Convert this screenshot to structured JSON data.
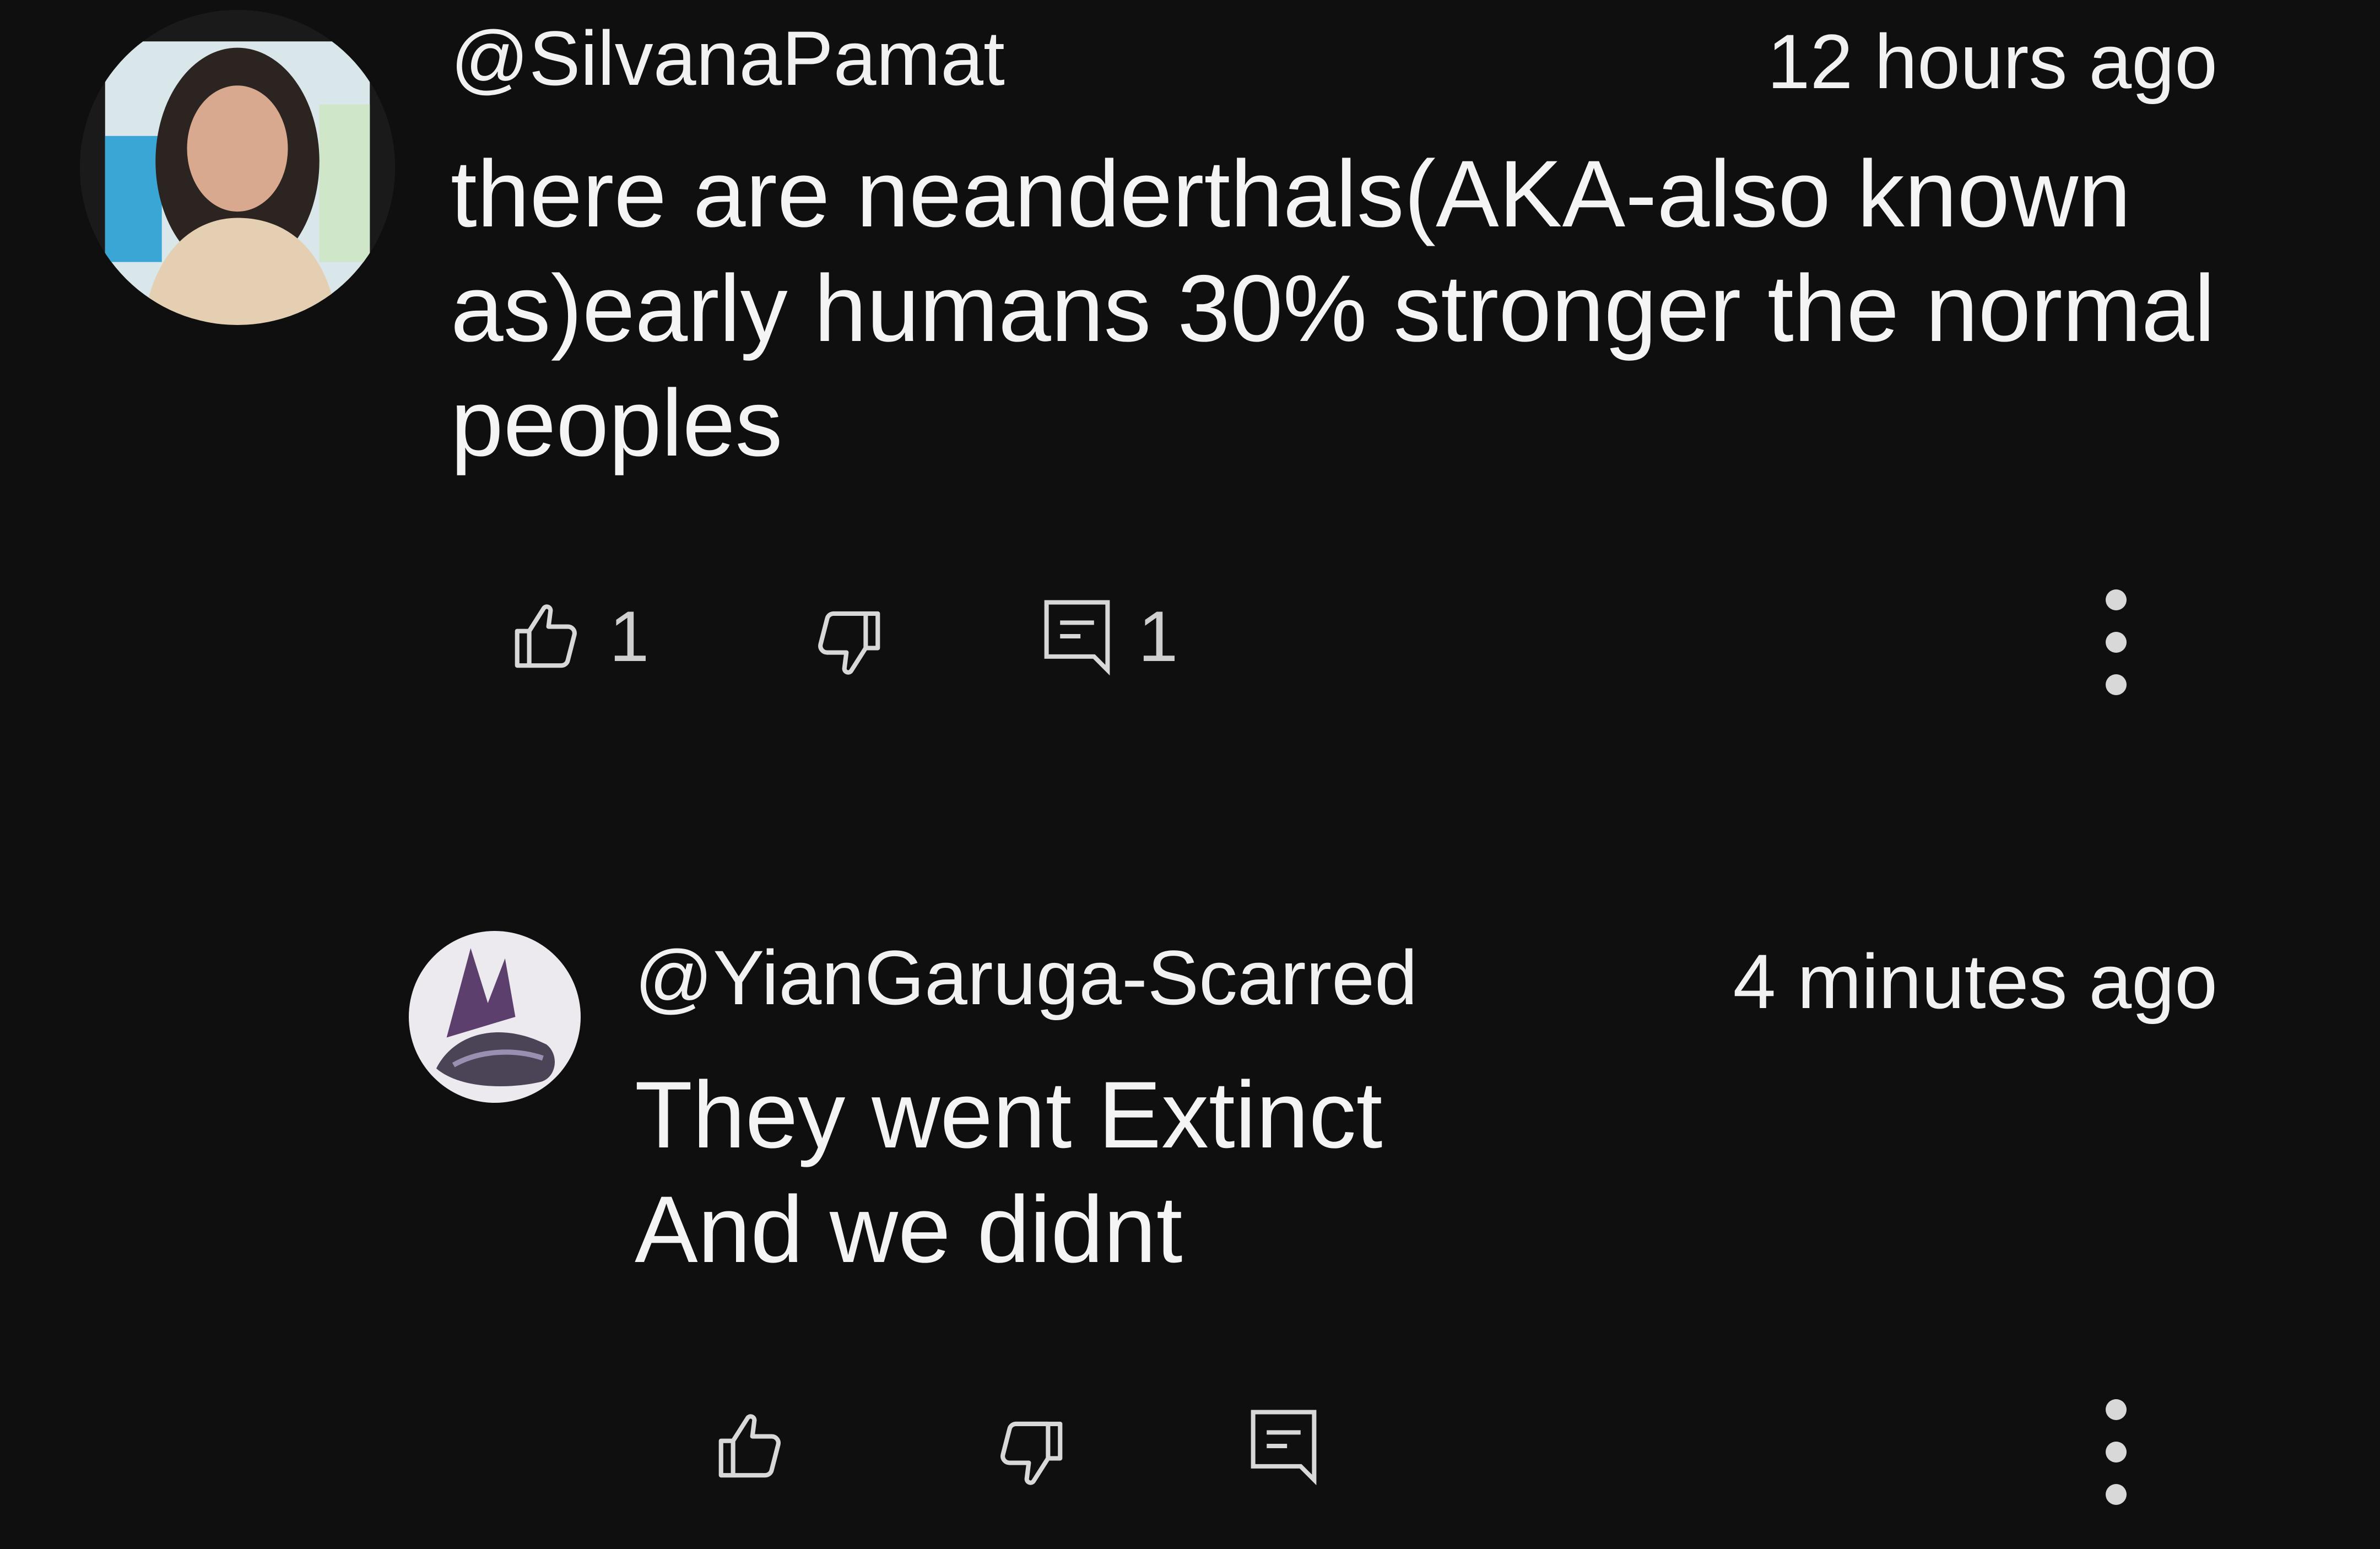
{
  "comments": [
    {
      "avatar_icon": "user-avatar-photo",
      "author": "@SilvanaPamat",
      "time": "12 hours ago",
      "text_lines": [
        "there are neanderthals(AKA-also known",
        "as)early humans 30% stronger the normal",
        "peoples"
      ],
      "like_count": "1",
      "reply_count": "1"
    },
    {
      "avatar_icon": "monster-avatar",
      "author": "@YianGaruga-Scarred",
      "time": "4 minutes ago",
      "text_lines": [
        "They went Extinct",
        "And we didnt"
      ]
    }
  ],
  "icons": {
    "like": "thumbs-up-icon",
    "dislike": "thumbs-down-icon",
    "reply": "reply-icon",
    "more": "more-vert-icon"
  },
  "colors": {
    "background": "#0f0f0f",
    "text": "#f1f1f1",
    "icon": "#d8d8d8"
  }
}
